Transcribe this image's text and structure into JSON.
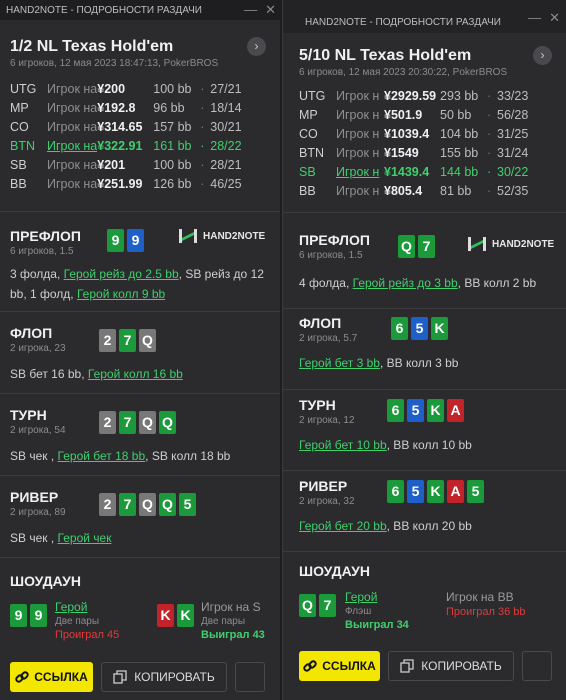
{
  "colors": {
    "hero": "#3fd06c",
    "win": "#3fd06c",
    "loss": "#e03a3a",
    "link_button": "#f3e600",
    "spade": "#787878",
    "heart": "#c2222a",
    "diamond": "#1f5fc9",
    "club": "#1a9a3a"
  },
  "windows": [
    {
      "title": "HAND2NOTE - ПОДРОБНОСТИ РАЗДАЧИ",
      "game": "1/2 NL Texas Hold'em",
      "meta": "6 игроков, 12 мая 2023 18:47:13, PokerBROS",
      "players": [
        {
          "pos": "UTG",
          "name": "Игрок на",
          "stack": "¥200",
          "bb": "100 bb",
          "record": "27/21",
          "hero": false
        },
        {
          "pos": "MP",
          "name": "Игрок на",
          "stack": "¥192.8",
          "bb": "96 bb",
          "record": "18/14",
          "hero": false
        },
        {
          "pos": "CO",
          "name": "Игрок на",
          "stack": "¥314.65",
          "bb": "157 bb",
          "record": "30/21",
          "hero": false
        },
        {
          "pos": "BTN",
          "name": "Игрок на",
          "stack": "¥322.91",
          "bb": "161 bb",
          "record": "28/22",
          "hero": true
        },
        {
          "pos": "SB",
          "name": "Игрок на",
          "stack": "¥201",
          "bb": "100 bb",
          "record": "28/21",
          "hero": false
        },
        {
          "pos": "BB",
          "name": "Игрок на",
          "stack": "¥251.99",
          "bb": "126 bb",
          "record": "46/25",
          "hero": false
        }
      ],
      "preflop": {
        "title": "ПРЕФЛОП",
        "sub": "6 игроков, 1.5",
        "cards": [
          {
            "r": "9",
            "s": "club"
          },
          {
            "r": "9",
            "s": "diamond"
          }
        ],
        "action": [
          {
            "t": "3 фолда, ",
            "h": false
          },
          {
            "t": "Герой рейз до 2.5 bb",
            "h": true
          },
          {
            "t": ", SB рейз до 12 bb, 1 фолд, ",
            "h": false
          },
          {
            "t": "Герой колл 9 bb",
            "h": true
          }
        ]
      },
      "flop": {
        "title": "ФЛОП",
        "sub": "2 игрока, 23",
        "cards": [
          {
            "r": "2",
            "s": "spade"
          },
          {
            "r": "7",
            "s": "club"
          },
          {
            "r": "Q",
            "s": "spade"
          }
        ],
        "action": [
          {
            "t": "SB бет 16 bb, ",
            "h": false
          },
          {
            "t": "Герой колл 16 bb",
            "h": true
          }
        ]
      },
      "turn": {
        "title": "ТУРН",
        "sub": "2 игрока, 54",
        "cards": [
          {
            "r": "2",
            "s": "spade"
          },
          {
            "r": "7",
            "s": "club"
          },
          {
            "r": "Q",
            "s": "spade"
          },
          {
            "r": "Q",
            "s": "club"
          }
        ],
        "action": [
          {
            "t": "SB чек , ",
            "h": false
          },
          {
            "t": "Герой бет 18 bb",
            "h": true
          },
          {
            "t": ", SB колл 18 bb",
            "h": false
          }
        ]
      },
      "river": {
        "title": "РИВЕР",
        "sub": "2 игрока, 89",
        "cards": [
          {
            "r": "2",
            "s": "spade"
          },
          {
            "r": "7",
            "s": "club"
          },
          {
            "r": "Q",
            "s": "spade"
          },
          {
            "r": "Q",
            "s": "club"
          },
          {
            "r": "5",
            "s": "club"
          }
        ],
        "action": [
          {
            "t": "SB чек , ",
            "h": false
          },
          {
            "t": "Герой чек",
            "h": true
          }
        ]
      },
      "showdown": {
        "title": "ШОУДАУН",
        "hero": {
          "name": "Герой",
          "hand": "Две пары",
          "result": "Проиграл 45",
          "win": false,
          "cards": [
            {
              "r": "9",
              "s": "club"
            },
            {
              "r": "9",
              "s": "club"
            }
          ]
        },
        "opp": {
          "name": "Игрок на S",
          "hand": "Две пары",
          "result": "Выиграл 43",
          "win": true,
          "cards": [
            {
              "r": "K",
              "s": "heart"
            },
            {
              "r": "K",
              "s": "club"
            }
          ]
        }
      },
      "link_label": "ССЫЛКА",
      "copy_label": "КОПИРОВАТЬ"
    },
    {
      "title": "HAND2NOTE - ПОДРОБНОСТИ РАЗДАЧИ",
      "game": "5/10 NL Texas Hold'em",
      "meta": "6 игроков, 12 мая 2023 20:30:22, PokerBROS",
      "players": [
        {
          "pos": "UTG",
          "name": "Игрок н",
          "stack": "¥2929.59",
          "bb": "293 bb",
          "record": "33/23",
          "hero": false
        },
        {
          "pos": "MP",
          "name": "Игрок н",
          "stack": "¥501.9",
          "bb": "50 bb",
          "record": "56/28",
          "hero": false
        },
        {
          "pos": "CO",
          "name": "Игрок н",
          "stack": "¥1039.4",
          "bb": "104 bb",
          "record": "31/25",
          "hero": false
        },
        {
          "pos": "BTN",
          "name": "Игрок н",
          "stack": "¥1549",
          "bb": "155 bb",
          "record": "31/24",
          "hero": false
        },
        {
          "pos": "SB",
          "name": "Игрок н",
          "stack": "¥1439.4",
          "bb": "144 bb",
          "record": "30/22",
          "hero": true
        },
        {
          "pos": "BB",
          "name": "Игрок н",
          "stack": "¥805.4",
          "bb": "81 bb",
          "record": "52/35",
          "hero": false
        }
      ],
      "preflop": {
        "title": "ПРЕФЛОП",
        "sub": "6 игроков, 1.5",
        "cards": [
          {
            "r": "Q",
            "s": "club"
          },
          {
            "r": "7",
            "s": "club"
          }
        ],
        "action": [
          {
            "t": "4 фолда, ",
            "h": false
          },
          {
            "t": "Герой рейз до 3 bb",
            "h": true
          },
          {
            "t": ", BB колл 2 bb",
            "h": false
          }
        ]
      },
      "flop": {
        "title": "ФЛОП",
        "sub": "2 игрока, 5.7",
        "cards": [
          {
            "r": "6",
            "s": "club"
          },
          {
            "r": "5",
            "s": "diamond"
          },
          {
            "r": "K",
            "s": "club"
          }
        ],
        "action": [
          {
            "t": "Герой бет 3 bb",
            "h": true
          },
          {
            "t": ", BB колл 3 bb",
            "h": false
          }
        ]
      },
      "turn": {
        "title": "ТУРН",
        "sub": "2 игрока, 12",
        "cards": [
          {
            "r": "6",
            "s": "club"
          },
          {
            "r": "5",
            "s": "diamond"
          },
          {
            "r": "K",
            "s": "club"
          },
          {
            "r": "A",
            "s": "heart"
          }
        ],
        "action": [
          {
            "t": "Герой бет 10 bb",
            "h": true
          },
          {
            "t": ", BB колл 10 bb",
            "h": false
          }
        ]
      },
      "river": {
        "title": "РИВЕР",
        "sub": "2 игрока, 32",
        "cards": [
          {
            "r": "6",
            "s": "club"
          },
          {
            "r": "5",
            "s": "diamond"
          },
          {
            "r": "K",
            "s": "club"
          },
          {
            "r": "A",
            "s": "heart"
          },
          {
            "r": "5",
            "s": "club"
          }
        ],
        "action": [
          {
            "t": "Герой бет 20 bb",
            "h": true
          },
          {
            "t": ", BB колл 20 bb",
            "h": false
          }
        ]
      },
      "showdown": {
        "title": "ШОУДАУН",
        "hero": {
          "name": "Герой",
          "hand": "Флэш",
          "result": "Выиграл 34",
          "win": true,
          "cards": [
            {
              "r": "Q",
              "s": "club"
            },
            {
              "r": "7",
              "s": "club"
            }
          ]
        },
        "opp": {
          "name": "Игрок на BB",
          "hand": "",
          "result": "Проиграл 36 bb",
          "win": false,
          "cards": []
        }
      },
      "link_label": "ССЫЛКА",
      "copy_label": "КОПИРОВАТЬ"
    }
  ],
  "logo_text": "HAND2NOTE"
}
